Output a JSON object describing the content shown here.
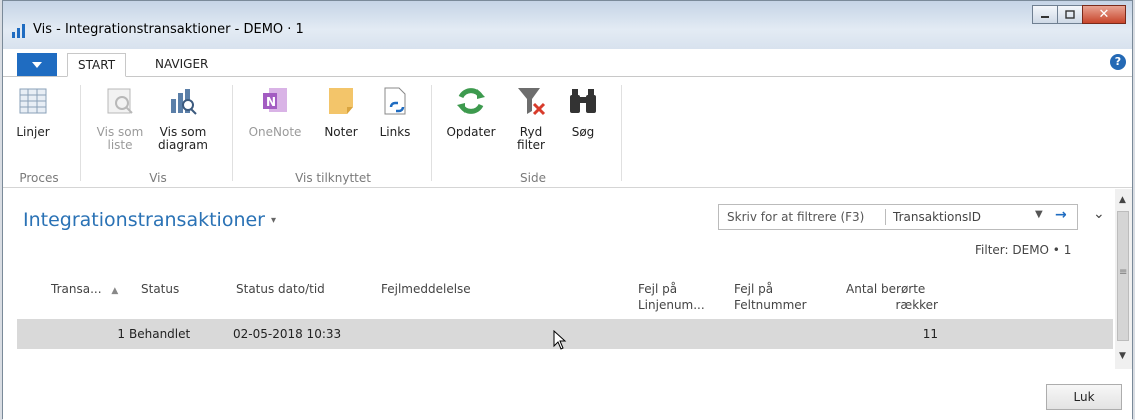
{
  "window": {
    "title": "Vis - Integrationstransaktioner - DEMO · 1"
  },
  "tabs": [
    "START",
    "NAVIGER"
  ],
  "ribbon": {
    "lines": "Linjer",
    "view_list": [
      "Vis som",
      "liste"
    ],
    "view_chart": [
      "Vis som",
      "diagram"
    ],
    "onenote": "OneNote",
    "notes": "Noter",
    "links": "Links",
    "refresh": "Opdater",
    "clear_filter": [
      "Ryd",
      "filter"
    ],
    "search": "Søg",
    "groups": [
      "Proces",
      "Vis",
      "Vis tilknyttet",
      "Side"
    ]
  },
  "page": {
    "title": "Integrationstransaktioner",
    "filter_placeholder": "Skriv for at filtrere (F3)",
    "filter_field": "TransaktionsID",
    "filter_label": "Filter: DEMO • 1"
  },
  "columns": [
    [
      "Transa..."
    ],
    [
      "Status"
    ],
    [
      "Status dato/tid"
    ],
    [
      "Fejlmeddelelse"
    ],
    [
      "Fejl på",
      "Linjenum..."
    ],
    [
      "Fejl på",
      "Feltnummer"
    ],
    [
      "Antal berørte",
      "rækker"
    ]
  ],
  "rows": [
    {
      "id": "1",
      "status": "Behandlet",
      "datetime": "02-05-2018 10:33",
      "count": "11"
    }
  ],
  "buttons": {
    "close": "Luk"
  },
  "colors": {
    "accent": "#1f6cc1",
    "title": "#2a72b5",
    "row_selected": "#d9d9d9"
  }
}
